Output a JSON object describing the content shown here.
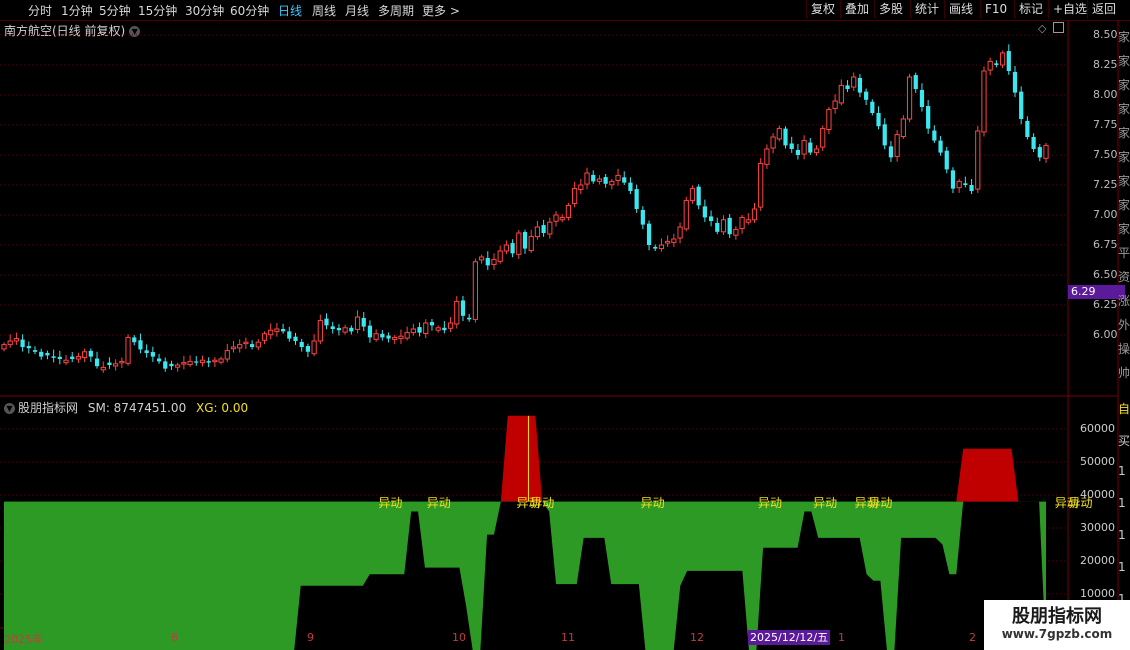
{
  "toolbar": {
    "periods": [
      "分时",
      "1分钟",
      "5分钟",
      "15分钟",
      "30分钟",
      "60分钟",
      "日线",
      "周线",
      "月线",
      "多周期",
      "更多 >"
    ],
    "active": "日线",
    "right": [
      "复权",
      "叠加",
      "多股",
      "统计",
      "画线",
      "F10",
      "标记",
      "+自选",
      "返回"
    ]
  },
  "stock": {
    "title": "南方航空(日线 前复权)"
  },
  "price_axis": [
    "8.50",
    "8.25",
    "8.00",
    "7.75",
    "7.50",
    "7.25",
    "7.00",
    "6.75",
    "6.50",
    "6.25",
    "6.00"
  ],
  "current_price": "6.29",
  "indicator": {
    "name": "股朋指标网",
    "sm": "SM: 8747451.00",
    "xg": "XG: 0.00",
    "label": "异动"
  },
  "indicator_axis": [
    "60000",
    "50000",
    "40000",
    "30000",
    "20000",
    "10000"
  ],
  "dates": {
    "year": "2025年",
    "months": [
      "8",
      "9",
      "10",
      "11",
      "12",
      "1",
      "2"
    ],
    "cursor": "2025/12/12/五"
  },
  "watermark": {
    "line1": "股朋指标网",
    "line2": "www.7gpzb.com"
  },
  "side_chars": [
    "家",
    "家",
    "家",
    "家",
    "家",
    "家",
    "家",
    "家",
    "家",
    "平",
    "资",
    "涨",
    "外",
    "操",
    "帅"
  ],
  "side_ind_chars": [
    "自",
    "买",
    "1",
    "1",
    "1",
    "1",
    "1",
    "1"
  ],
  "colors": {
    "up": "#ff4444",
    "down": "#3ae8f0",
    "green": "#2e9a26",
    "red": "#c00000",
    "yellow": "#f0e020"
  },
  "chart_data": [
    {
      "type": "candlestick",
      "ylim": [
        5.6,
        8.6
      ],
      "closes": [
        5.92,
        5.95,
        5.97,
        5.9,
        5.89,
        5.86,
        5.82,
        5.83,
        5.81,
        5.8,
        5.79,
        5.8,
        5.82,
        5.86,
        5.82,
        5.74,
        5.73,
        5.75,
        5.76,
        5.78,
        5.98,
        5.94,
        5.88,
        5.85,
        5.82,
        5.78,
        5.72,
        5.74,
        5.75,
        5.77,
        5.78,
        5.77,
        5.79,
        5.77,
        5.79,
        5.8,
        5.87,
        5.9,
        5.92,
        5.94,
        5.9,
        5.94,
        6.01,
        6.04,
        6.05,
        6.03,
        5.97,
        5.95,
        5.9,
        5.86,
        5.95,
        6.12,
        6.08,
        6.05,
        6.04,
        6.06,
        6.03,
        6.15,
        6.07,
        5.98,
        6.01,
        5.98,
        5.97,
        5.98,
        5.99,
        6.02,
        6.05,
        6.02,
        6.1,
        6.08,
        6.06,
        6.04,
        6.1,
        6.28,
        6.16,
        6.13,
        6.61,
        6.65,
        6.58,
        6.63,
        6.7,
        6.75,
        6.68,
        6.85,
        6.72,
        6.82,
        6.9,
        6.85,
        6.94,
        7.0,
        6.98,
        7.08,
        7.22,
        7.25,
        7.35,
        7.28,
        7.3,
        7.26,
        7.28,
        7.33,
        7.27,
        7.2,
        7.05,
        6.92,
        6.75,
        6.72,
        6.75,
        6.78,
        6.8,
        6.9,
        7.12,
        7.22,
        7.08,
        6.98,
        6.95,
        6.86,
        6.96,
        6.84,
        6.88,
        6.98,
        6.96,
        7.05,
        7.43,
        7.55,
        7.65,
        7.72,
        7.58,
        7.55,
        7.5,
        7.62,
        7.52,
        7.55,
        7.72,
        7.88,
        7.95,
        8.08,
        8.05,
        8.15,
        8.02,
        7.96,
        7.85,
        7.74,
        7.58,
        7.48,
        7.67,
        7.8,
        8.15,
        8.05,
        7.9,
        7.72,
        7.62,
        7.52,
        7.38,
        7.22,
        7.28,
        7.25,
        7.2,
        7.7,
        8.2,
        8.28,
        8.25,
        8.35,
        8.2,
        8.02,
        7.8,
        7.65,
        7.55,
        7.48,
        7.58
      ],
      "annotations": [
        "异动"
      ]
    },
    {
      "type": "area",
      "ylim": [
        0,
        65000
      ],
      "base_line": 38000,
      "values": [
        0,
        0,
        0,
        0,
        0,
        0,
        0,
        0,
        0,
        0,
        0,
        0,
        0,
        0,
        0,
        0,
        0,
        0,
        0,
        0,
        0,
        0,
        0,
        0,
        0,
        0,
        0,
        0,
        0,
        0,
        0,
        0,
        0,
        0,
        0,
        0,
        0,
        0,
        0,
        0,
        0,
        0,
        0,
        12500,
        12500,
        12500,
        12500,
        12500,
        12500,
        12500,
        12500,
        12500,
        12500,
        16000,
        16000,
        16000,
        16000,
        16000,
        16000,
        35000,
        35000,
        18000,
        18000,
        18000,
        18000,
        18000,
        18000,
        6000,
        0,
        0,
        28000,
        28000,
        38000,
        64000,
        64000,
        64000,
        64000,
        64000,
        38000,
        35000,
        13000,
        13000,
        13000,
        13000,
        27000,
        27000,
        27000,
        27000,
        13000,
        13000,
        13000,
        13000,
        13000,
        0,
        0,
        0,
        0,
        0,
        12500,
        17000,
        17000,
        17000,
        17000,
        17000,
        17000,
        17000,
        17000,
        17000,
        0,
        0,
        24000,
        24000,
        24000,
        24000,
        24000,
        24000,
        35000,
        35000,
        27000,
        27000,
        27000,
        27000,
        27000,
        27000,
        27000,
        16000,
        14000,
        14000,
        0,
        0,
        27000,
        27000,
        27000,
        27000,
        27000,
        27000,
        25000,
        16000,
        16000,
        54000,
        54000,
        54000,
        54000,
        54000,
        54000,
        54000,
        54000,
        38000,
        38000,
        38000,
        38000,
        0
      ],
      "signals": [
        56,
        63,
        76,
        78,
        94,
        111,
        119,
        125,
        127,
        154,
        156
      ]
    }
  ]
}
